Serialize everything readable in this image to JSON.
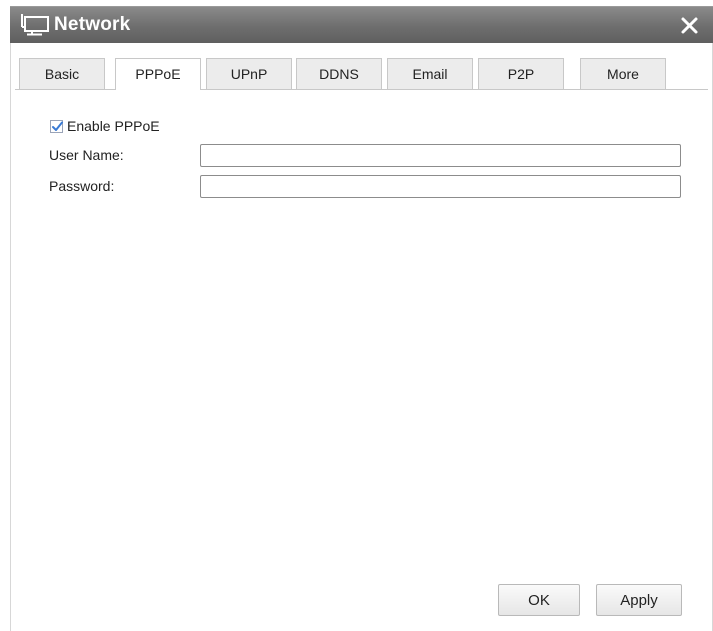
{
  "window": {
    "title": "Network",
    "icon": "network-monitor-icon",
    "close_icon": "close-icon"
  },
  "tabs": [
    {
      "label": "Basic",
      "active": false
    },
    {
      "label": "PPPoE",
      "active": true
    },
    {
      "label": "UPnP",
      "active": false
    },
    {
      "label": "DDNS",
      "active": false
    },
    {
      "label": "Email",
      "active": false
    },
    {
      "label": "P2P",
      "active": false
    },
    {
      "label": "More",
      "active": false
    }
  ],
  "pppoe": {
    "enable_label": "Enable PPPoE",
    "enable_checked": true,
    "username_label": "User Name:",
    "username_value": "",
    "password_label": "Password:",
    "password_value": ""
  },
  "footer": {
    "ok_label": "OK",
    "apply_label": "Apply"
  },
  "colors": {
    "titlebar": "#6e6e6e",
    "checkmark": "#3a7bd5",
    "tab_inactive": "#ececec",
    "tab_active": "#ffffff"
  }
}
